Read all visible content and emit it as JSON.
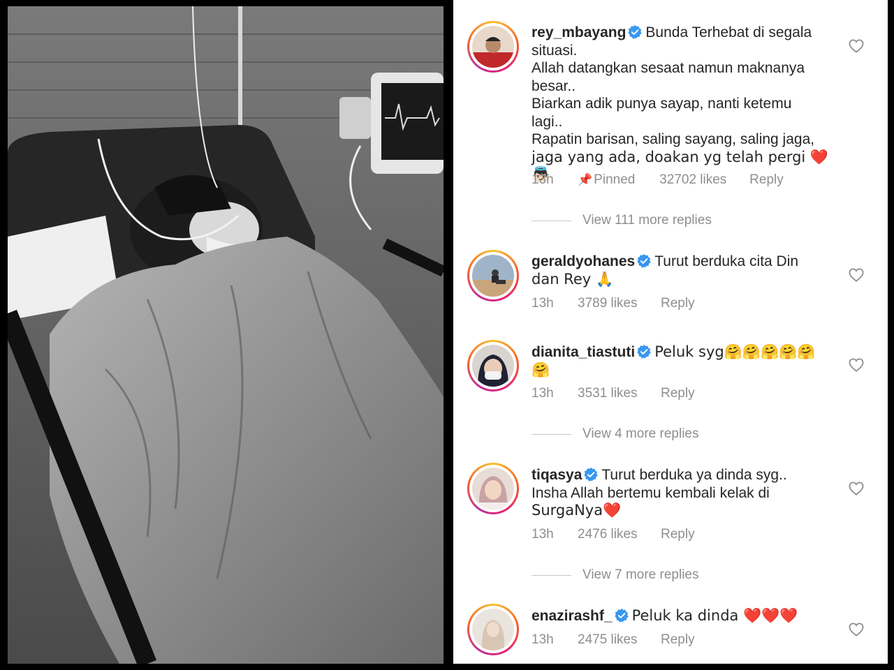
{
  "colors": {
    "panel_bg": "#ffffff",
    "text": "#262626",
    "muted": "#8e8e8e",
    "verified": "#3897f0",
    "heart": "#e0192d"
  },
  "photo": {
    "subject": "black-and-white hospital bed photo"
  },
  "comments": [
    {
      "username": "rey_mbayang",
      "verified": true,
      "lines": [
        "Bunda Terhebat di segala",
        "situasi.",
        "Allah datangkan sesaat namun maknanya",
        "besar..",
        "Biarkan adik punya sayap, nanti ketemu",
        "lagi..",
        "Rapatin barisan, saling sayang, saling jaga,",
        "jaga yang ada, doakan yg telah pergi ❤️👼🏻"
      ],
      "time": "13h",
      "pinned_label": "Pinned",
      "likes": "32702 likes",
      "reply": "Reply",
      "view_replies": "View 111 more replies"
    },
    {
      "username": "geraldyohanes",
      "verified": true,
      "lines": [
        "Turut berduka cita Din",
        "dan Rey 🙏"
      ],
      "time": "13h",
      "likes": "3789 likes",
      "reply": "Reply"
    },
    {
      "username": "dianita_tiastuti",
      "verified": true,
      "lines": [
        "Peluk syg🤗🤗🤗🤗🤗",
        "🤗"
      ],
      "time": "13h",
      "likes": "3531 likes",
      "reply": "Reply",
      "view_replies": "View 4 more replies"
    },
    {
      "username": "tiqasya",
      "verified": true,
      "lines": [
        "Turut berduka ya dinda syg..",
        "Insha Allah bertemu kembali kelak di",
        "SurgaNya❤️"
      ],
      "time": "13h",
      "likes": "2476 likes",
      "reply": "Reply",
      "view_replies": "View 7 more replies"
    },
    {
      "username": "enazirashf_",
      "verified": true,
      "lines": [
        "Peluk ka dinda ❤️❤️❤️"
      ],
      "time": "13h",
      "likes": "2475 likes",
      "reply": "Reply"
    }
  ]
}
